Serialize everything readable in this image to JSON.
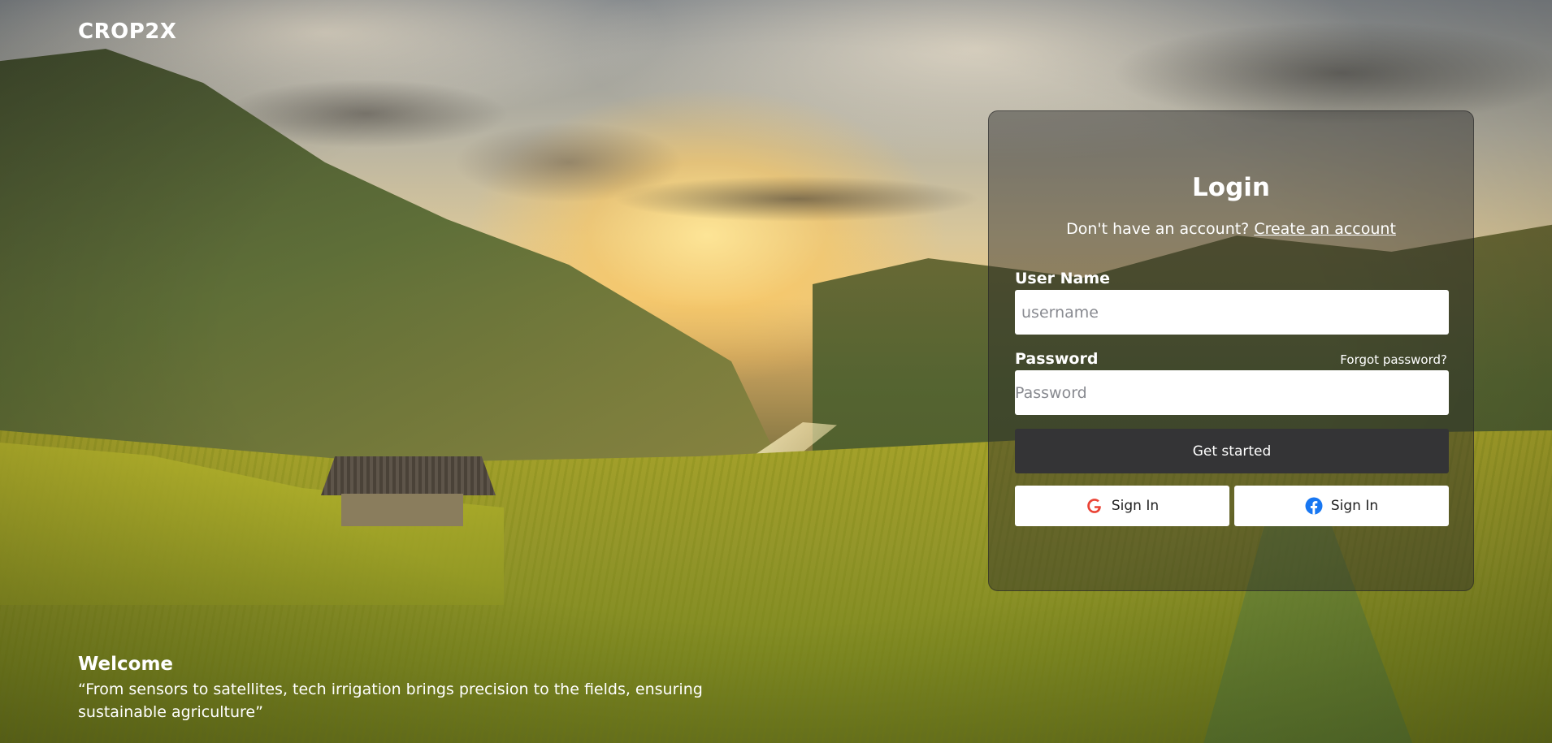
{
  "brand": {
    "name": "CROP2X"
  },
  "welcome": {
    "title": "Welcome",
    "quote": "“From sensors to satellites, tech irrigation brings precision to the fields, ensuring sustainable agriculture”"
  },
  "login": {
    "title": "Login",
    "no_account_text": "Don't have an account?",
    "create_account_link": "Create an account",
    "username_label": "User Name",
    "username_placeholder": "username",
    "password_label": "Password",
    "password_placeholder": "Password",
    "forgot_password": "Forgot password?",
    "submit_label": "Get started",
    "google_signin_label": "Sign In",
    "facebook_signin_label": "Sign In",
    "google_icon": "google-logo-icon",
    "facebook_icon": "facebook-logo-icon"
  },
  "colors": {
    "primary_button": "#343436",
    "card_overlay": "rgba(40,40,40,0.45)",
    "text_light": "#ffffff",
    "facebook_blue": "#1877f2",
    "google_red": "#ea4335"
  }
}
